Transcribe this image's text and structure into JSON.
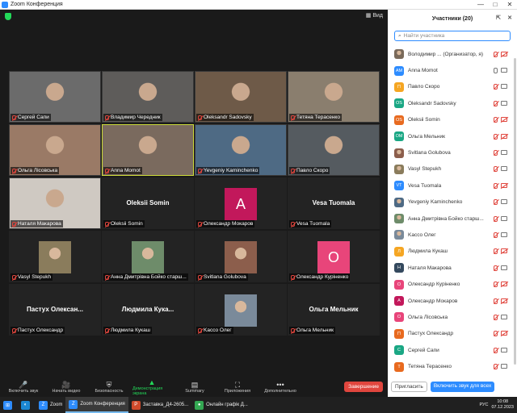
{
  "window": {
    "title": "Zoom Конференция",
    "controls": [
      "—",
      "□",
      "✕"
    ]
  },
  "meeting": {
    "view_label": "Вид"
  },
  "tiles": [
    {
      "label": "Сергей Сапи",
      "kind": "video",
      "bg": "#6b6b6b",
      "active": false
    },
    {
      "label": "Владимир Чередник",
      "kind": "video",
      "bg": "#5e5c5a",
      "active": false
    },
    {
      "label": "Oleksandr Sadovsky",
      "kind": "video",
      "bg": "#6e5a48",
      "active": false
    },
    {
      "label": "Тетяна Терасенко",
      "kind": "video",
      "bg": "#8a7e6e",
      "active": false
    },
    {
      "label": "Ольга Лісовська",
      "kind": "video",
      "bg": "#9a7a66",
      "active": false
    },
    {
      "label": "Anna Momot",
      "kind": "video",
      "bg": "#7a6a5e",
      "active": true
    },
    {
      "label": "Yevgeniy Kaminchenko",
      "kind": "video",
      "bg": "#4e6a84",
      "active": false
    },
    {
      "label": "Павло Скоро",
      "kind": "video",
      "bg": "#555b60",
      "active": false
    },
    {
      "label": "Наталя Макарова",
      "kind": "video",
      "bg": "#cfc9c2",
      "active": false
    },
    {
      "label": "Oleksii Somin",
      "kind": "name",
      "big": "Oleksii Somin"
    },
    {
      "label": "Олександр Мокаров",
      "kind": "avatar",
      "letter": "A",
      "color": "#c2185b"
    },
    {
      "label": "Vesa Tuomala",
      "kind": "name",
      "big": "Vesa Tuomala"
    },
    {
      "label": "Vasyl Stepukh",
      "kind": "photo",
      "color": "#8a7c5c"
    },
    {
      "label": "Анна Дмитрівна Бойко старш...",
      "kind": "photo",
      "color": "#6e8c6a"
    },
    {
      "label": "Svitlana Golubova",
      "kind": "photo",
      "color": "#8c5e4c"
    },
    {
      "label": "Олександр Куріненко",
      "kind": "avatar",
      "letter": "O",
      "color": "#e8457a"
    },
    {
      "label": "Пастух Олександр",
      "kind": "name",
      "big": "Пастух Олексан..."
    },
    {
      "label": "Людмила Кукаш",
      "kind": "name",
      "big": "Людмила Кука..."
    },
    {
      "label": "Kacco Олег",
      "kind": "photo",
      "color": "#7a8a9a"
    },
    {
      "label": "Ольга Мельник",
      "kind": "name",
      "big": "Ольга Мельник"
    }
  ],
  "toolbar": [
    {
      "label": "Включить звук",
      "icon": "🎤",
      "green": false
    },
    {
      "label": "Начать видео",
      "icon": "🎥",
      "green": false
    },
    {
      "label": "Безопасность",
      "icon": "⛨",
      "green": false
    },
    {
      "label": "Демонстрация экрана",
      "icon": "▲",
      "green": true
    },
    {
      "label": "Summary",
      "icon": "▤",
      "green": false
    },
    {
      "label": "Приложения",
      "icon": "⛶",
      "green": false
    },
    {
      "label": "Дополнительно",
      "icon": "•••",
      "green": false
    }
  ],
  "end_button": "Завершение",
  "panel": {
    "title": "Участники (20)",
    "search_placeholder": "Найти участника",
    "participants": [
      {
        "initials": "",
        "name": "Володимир ...  (Организатор, я)",
        "color": "#7a6a5a",
        "photo": true,
        "mic": false,
        "cam": false
      },
      {
        "initials": "AM",
        "name": "Anna Momot",
        "color": "#2d8cff",
        "photo": false,
        "mic": true,
        "cam": true
      },
      {
        "initials": "П",
        "name": "Павло Скоро",
        "color": "#f5a623",
        "photo": false,
        "mic": false,
        "cam": true
      },
      {
        "initials": "OS",
        "name": "Oleksandr Sadovsky",
        "color": "#1aa784",
        "photo": false,
        "mic": false,
        "cam": true
      },
      {
        "initials": "OS",
        "name": "Oleksii Somin",
        "color": "#e86a1f",
        "photo": false,
        "mic": false,
        "cam": false
      },
      {
        "initials": "OM",
        "name": "Ольга Мельник",
        "color": "#1aa784",
        "photo": false,
        "mic": false,
        "cam": false
      },
      {
        "initials": "",
        "name": "Svitlana Golubova",
        "color": "#8c5e4c",
        "photo": true,
        "mic": false,
        "cam": true
      },
      {
        "initials": "",
        "name": "Vasyl Stepukh",
        "color": "#8a7c5c",
        "photo": true,
        "mic": false,
        "cam": true
      },
      {
        "initials": "VT",
        "name": "Vesa Tuomala",
        "color": "#2d8cff",
        "photo": false,
        "mic": false,
        "cam": false
      },
      {
        "initials": "",
        "name": "Yevgeniy Kaminchenko",
        "color": "#4e6a84",
        "photo": true,
        "mic": false,
        "cam": true
      },
      {
        "initials": "",
        "name": "Анна Дмитрівна Бойко старш...",
        "color": "#6e8c6a",
        "photo": true,
        "mic": false,
        "cam": true
      },
      {
        "initials": "",
        "name": "Kacco Олег",
        "color": "#7a8a9a",
        "photo": true,
        "mic": false,
        "cam": true
      },
      {
        "initials": "Л",
        "name": "Людмила Кукаш",
        "color": "#f5a623",
        "photo": false,
        "mic": false,
        "cam": false
      },
      {
        "initials": "Н",
        "name": "Наталя Макарова",
        "color": "#34495e",
        "photo": false,
        "mic": false,
        "cam": true
      },
      {
        "initials": "O",
        "name": "Олександр Куріненко",
        "color": "#e8457a",
        "photo": false,
        "mic": false,
        "cam": false
      },
      {
        "initials": "A",
        "name": "Олександр Мокаров",
        "color": "#c2185b",
        "photo": false,
        "mic": false,
        "cam": false
      },
      {
        "initials": "O",
        "name": "Ольга Лісовська",
        "color": "#e8457a",
        "photo": false,
        "mic": false,
        "cam": true
      },
      {
        "initials": "П",
        "name": "Пастух Олександр",
        "color": "#e86a1f",
        "photo": false,
        "mic": false,
        "cam": false
      },
      {
        "initials": "С",
        "name": "Сергей Сапи",
        "color": "#1aa784",
        "photo": false,
        "mic": false,
        "cam": true
      },
      {
        "initials": "Т",
        "name": "Тетяна Терасенко",
        "color": "#e86a1f",
        "photo": false,
        "mic": false,
        "cam": true
      }
    ],
    "invite_label": "Пригласить",
    "unmute_all_label": "Включить звук для всех"
  },
  "taskbar": {
    "items": [
      {
        "label": "",
        "icon": "⊞",
        "color": "#2d8cff",
        "sel": false
      },
      {
        "label": "",
        "icon": "◐",
        "color": "#1b88d2",
        "sel": false
      },
      {
        "label": "Zoom",
        "icon": "Z",
        "color": "#2d8cff",
        "sel": false
      },
      {
        "label": "Zoom Конференция",
        "icon": "Z",
        "color": "#2d8cff",
        "sel": true
      },
      {
        "label": "Заставка_Д4-2605...",
        "icon": "P",
        "color": "#d04a2b",
        "sel": false
      },
      {
        "label": "Онлайн графік Д...",
        "icon": "●",
        "color": "#34a853",
        "sel": false
      }
    ],
    "lang": "РУС",
    "time": "10:08",
    "date": "07.12.2023"
  }
}
